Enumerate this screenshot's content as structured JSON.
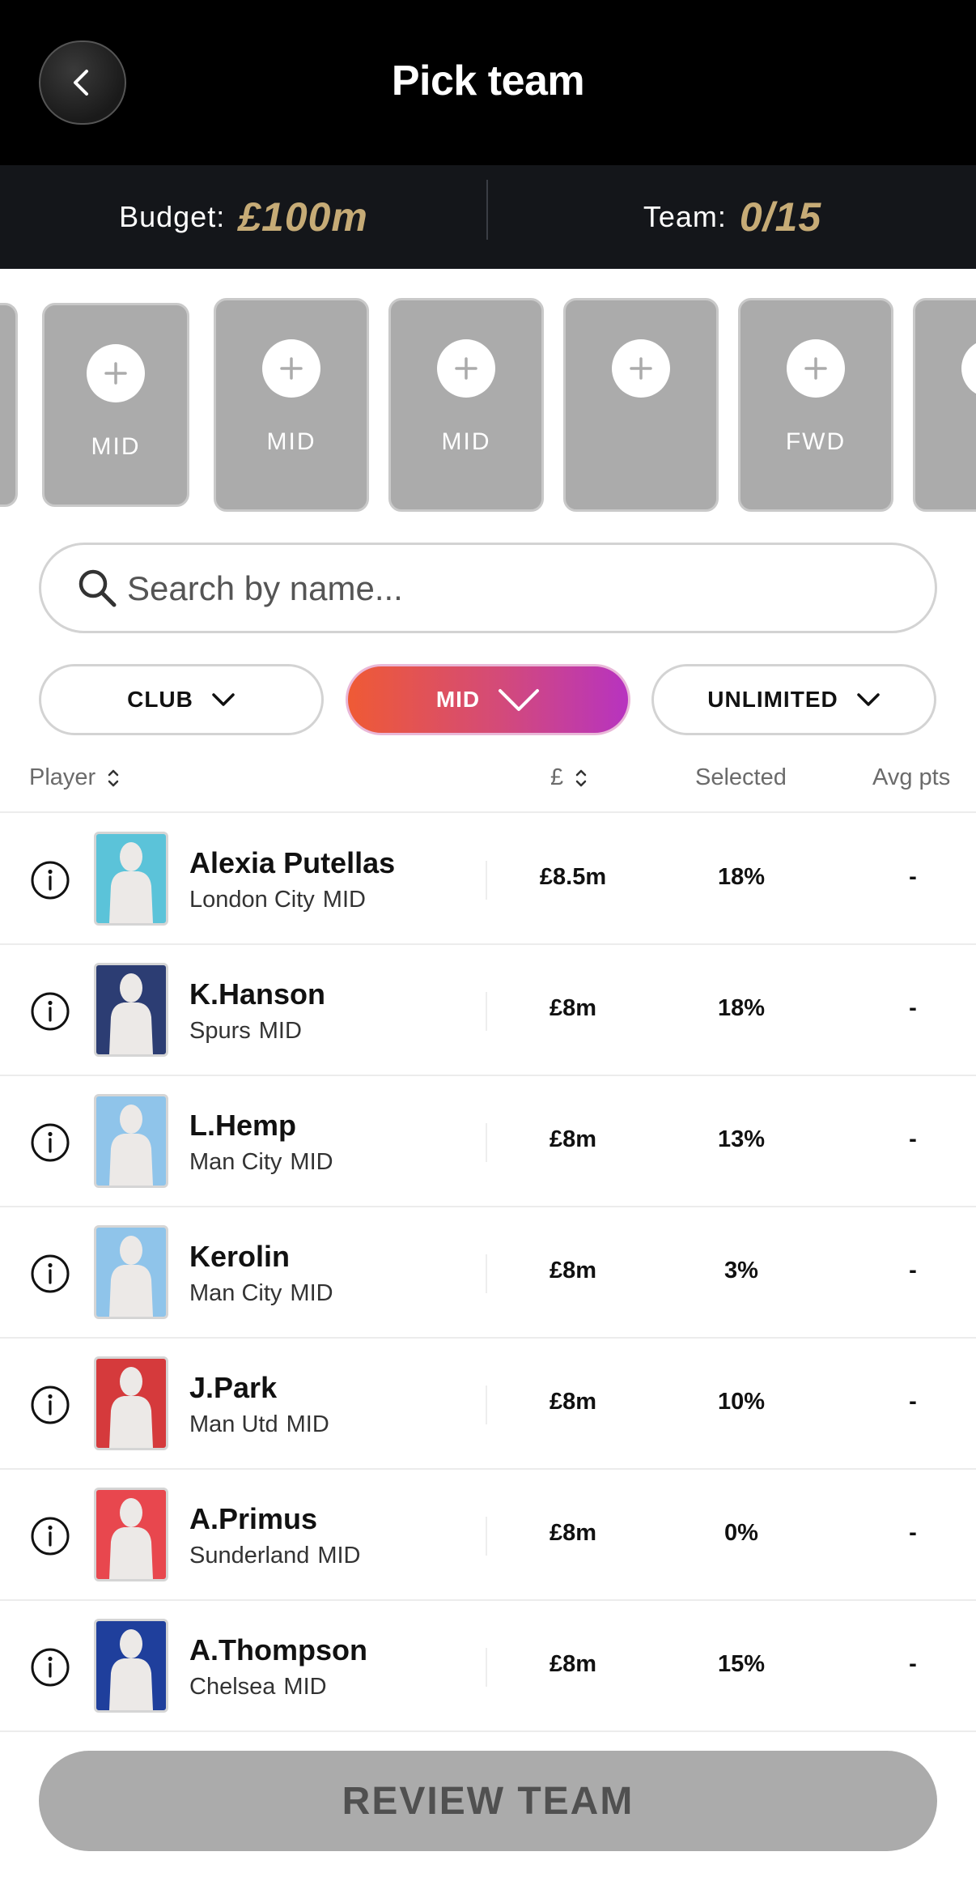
{
  "header": {
    "title": "Pick team",
    "back_icon": "chevron-left-icon"
  },
  "summary": {
    "budget_label": "Budget:",
    "budget_value": "£100m",
    "team_label": "Team:",
    "team_value": "0/15",
    "accent_color": "#c6ab76"
  },
  "slots": [
    {
      "position": ""
    },
    {
      "position": "MID"
    },
    {
      "position": "MID"
    },
    {
      "position": "MID"
    },
    {
      "position": ""
    },
    {
      "position": "FWD"
    },
    {
      "position": "F"
    }
  ],
  "search": {
    "placeholder": "Search by name..."
  },
  "filters": {
    "club": "CLUB",
    "position": "MID",
    "price": "UNLIMITED",
    "active_gradient": [
      "#ef5a35",
      "#b733c0"
    ]
  },
  "table": {
    "headers": {
      "player": "Player",
      "price": "£",
      "selected": "Selected",
      "avg": "Avg pts"
    },
    "rows": [
      {
        "name": "Alexia Putellas",
        "club": "London City",
        "position": "MID",
        "price": "£8.5m",
        "selected": "18%",
        "avg": "-",
        "kit": "#5bc3d9"
      },
      {
        "name": "K.Hanson",
        "club": "Spurs",
        "position": "MID",
        "price": "£8m",
        "selected": "18%",
        "avg": "-",
        "kit": "#2c3d73"
      },
      {
        "name": "L.Hemp",
        "club": "Man City",
        "position": "MID",
        "price": "£8m",
        "selected": "13%",
        "avg": "-",
        "kit": "#8fc4ea"
      },
      {
        "name": "Kerolin",
        "club": "Man City",
        "position": "MID",
        "price": "£8m",
        "selected": "3%",
        "avg": "-",
        "kit": "#8fc4ea"
      },
      {
        "name": "J.Park",
        "club": "Man Utd",
        "position": "MID",
        "price": "£8m",
        "selected": "10%",
        "avg": "-",
        "kit": "#d53a3c"
      },
      {
        "name": "A.Primus",
        "club": "Sunderland",
        "position": "MID",
        "price": "£8m",
        "selected": "0%",
        "avg": "-",
        "kit": "#e8474e"
      },
      {
        "name": "A.Thompson",
        "club": "Chelsea",
        "position": "MID",
        "price": "£8m",
        "selected": "15%",
        "avg": "-",
        "kit": "#1f3f9c"
      }
    ]
  },
  "footer": {
    "review_label": "REVIEW TEAM"
  }
}
